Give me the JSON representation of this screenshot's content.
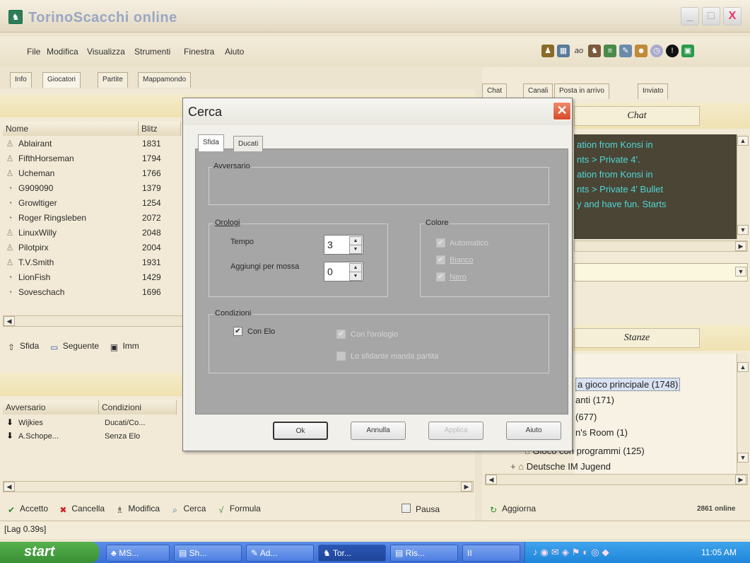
{
  "window": {
    "title": "TorinoScacchi online",
    "min": "_",
    "max": "□",
    "close": "X"
  },
  "menu": [
    "File",
    "Modifica",
    "Visualizza",
    "Strumenti",
    "Finestra",
    "Aiuto"
  ],
  "left_tabs": [
    "Info",
    "Giocatori",
    "Partite",
    "Mappamondo"
  ],
  "right_tabs": [
    "Chat",
    "Canali",
    "Posta in arrivo",
    "Inviato"
  ],
  "players": {
    "headers": [
      "Nome",
      "Blitz"
    ],
    "rows": [
      {
        "name": "Ablairant",
        "blitz": "1831"
      },
      {
        "name": "FifthHorseman",
        "blitz": "1794"
      },
      {
        "name": "Ucheman",
        "blitz": "1766"
      },
      {
        "name": "G909090",
        "blitz": "1379"
      },
      {
        "name": "Growltiger",
        "blitz": "1254"
      },
      {
        "name": "Roger Ringsleben",
        "blitz": "2072"
      },
      {
        "name": "LinuxWilly",
        "blitz": "2048"
      },
      {
        "name": "Pilotpirx",
        "blitz": "2004"
      },
      {
        "name": "T.V.Smith",
        "blitz": "1931"
      },
      {
        "name": "LionFish",
        "blitz": "1429"
      },
      {
        "name": "Soveschach",
        "blitz": "1696"
      }
    ]
  },
  "player_actions": [
    "Sfida",
    "Seguente",
    "Imm"
  ],
  "challenges": {
    "headers": [
      "Avversario",
      "Condizioni"
    ],
    "rows": [
      {
        "name": "Wijkies",
        "cond": "Ducati/Co..."
      },
      {
        "name": "A.Schope...",
        "cond": "Senza Elo"
      }
    ]
  },
  "bottom_actions": {
    "accetto": "Accetto",
    "cancella": "Cancella",
    "modifica": "Modifica",
    "cerca": "Cerca",
    "formula": "Formula",
    "pausa": "Pausa"
  },
  "lag": "[Lag 0.39s]",
  "chat": {
    "header": "Chat",
    "lines": [
      "ation from Konsi in",
      "nts > Private 4'.",
      "ation from Konsi in",
      "nts > Private 4' Bullet",
      "y and have fun. Starts"
    ]
  },
  "rooms": {
    "header": "Stanze",
    "items": [
      "a gioco principale  (1748)",
      "anti  (171)",
      "(677)",
      "n's Room  (1)",
      "Gioco con programmi  (125)",
      "Deutsche IM Jugend"
    ]
  },
  "right_footer": {
    "refresh": "Aggiorna",
    "online": "2861 online"
  },
  "dialog": {
    "title": "Cerca",
    "tabs": [
      "Sfida",
      "Ducati"
    ],
    "avversario": "Avversario",
    "orologi": {
      "label": "Orologi",
      "tempo": "Tempo",
      "tempo_val": "3",
      "aggiungi": "Aggiungi per mossa",
      "aggiungi_val": "0"
    },
    "colore": {
      "label": "Colore",
      "opts": [
        "Automatico",
        "Bianco",
        "Nero"
      ]
    },
    "condizioni": {
      "label": "Condizioni",
      "con_elo": "Con Elo",
      "con_orologio": "Con l'orologio",
      "lo_sfidante": "Lo sfidante manda partita"
    },
    "buttons": {
      "ok": "Ok",
      "annulla": "Annulla",
      "applica": "Applica",
      "aiuto": "Aiuto"
    }
  },
  "taskbar": {
    "start": "start",
    "tasks": [
      "MS...",
      "Sh...",
      "Ad...",
      "Tor...",
      "Ris...",
      "II"
    ],
    "clock": "11:05 AM"
  },
  "colors": {
    "chat_bg": "#4b4535",
    "chat_text": "#4fd6d4",
    "taskbar": "#3a6fd8",
    "start": "#3a8f35",
    "close": "#d84a28"
  }
}
